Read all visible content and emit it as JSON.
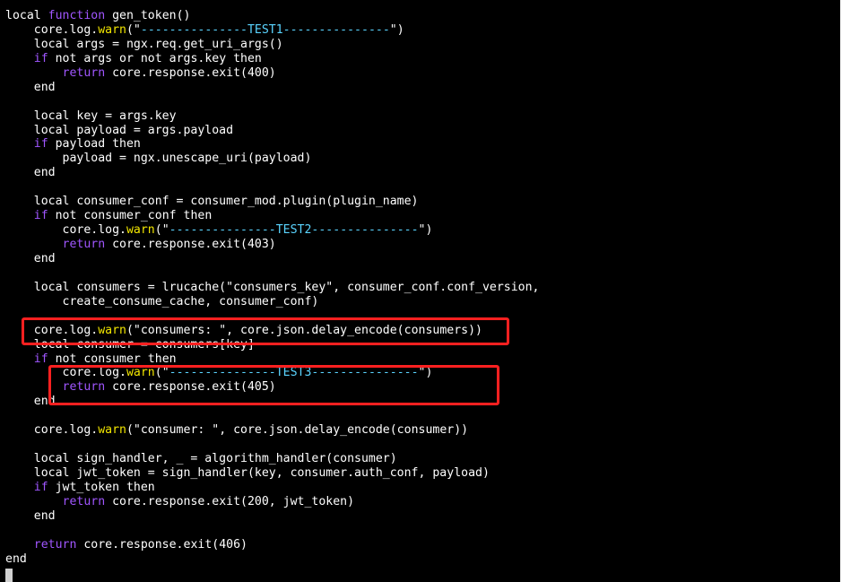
{
  "colors": {
    "background": "#000000",
    "text": "#ffffff",
    "keyword": "#a056ff",
    "warn": "#f2e600",
    "string_dash": "#5ad4ff",
    "highlight_box": "#ff2020"
  },
  "editor": {
    "lines": [
      [
        {
          "t": "local ",
          "c": "p"
        },
        {
          "t": "function",
          "c": "k"
        },
        {
          "t": " gen_token()",
          "c": "p"
        }
      ],
      [
        {
          "t": "    core.log.",
          "c": "p"
        },
        {
          "t": "warn",
          "c": "w"
        },
        {
          "t": "(\"",
          "c": "p"
        },
        {
          "t": "---------------TEST1---------------",
          "c": "c"
        },
        {
          "t": "\")",
          "c": "p"
        }
      ],
      [
        {
          "t": "    local args = ngx.req.get_uri_args()",
          "c": "p"
        }
      ],
      [
        {
          "t": "    ",
          "c": "p"
        },
        {
          "t": "if",
          "c": "k"
        },
        {
          "t": " not args or not args.key then",
          "c": "p"
        }
      ],
      [
        {
          "t": "        ",
          "c": "p"
        },
        {
          "t": "return",
          "c": "k"
        },
        {
          "t": " core.response.exit(400)",
          "c": "p"
        }
      ],
      [
        {
          "t": "    end",
          "c": "p"
        }
      ],
      [
        {
          "t": "",
          "c": "p"
        }
      ],
      [
        {
          "t": "    local key = args.key",
          "c": "p"
        }
      ],
      [
        {
          "t": "    local payload = args.payload",
          "c": "p"
        }
      ],
      [
        {
          "t": "    ",
          "c": "p"
        },
        {
          "t": "if",
          "c": "k"
        },
        {
          "t": " payload then",
          "c": "p"
        }
      ],
      [
        {
          "t": "        payload = ngx.unescape_uri(payload)",
          "c": "p"
        }
      ],
      [
        {
          "t": "    end",
          "c": "p"
        }
      ],
      [
        {
          "t": "",
          "c": "p"
        }
      ],
      [
        {
          "t": "    local consumer_conf = consumer_mod.plugin(plugin_name)",
          "c": "p"
        }
      ],
      [
        {
          "t": "    ",
          "c": "p"
        },
        {
          "t": "if",
          "c": "k"
        },
        {
          "t": " not consumer_conf then",
          "c": "p"
        }
      ],
      [
        {
          "t": "        core.log.",
          "c": "p"
        },
        {
          "t": "warn",
          "c": "w"
        },
        {
          "t": "(\"",
          "c": "p"
        },
        {
          "t": "---------------TEST2---------------",
          "c": "c"
        },
        {
          "t": "\")",
          "c": "p"
        }
      ],
      [
        {
          "t": "        ",
          "c": "p"
        },
        {
          "t": "return",
          "c": "k"
        },
        {
          "t": " core.response.exit(403)",
          "c": "p"
        }
      ],
      [
        {
          "t": "    end",
          "c": "p"
        }
      ],
      [
        {
          "t": "",
          "c": "p"
        }
      ],
      [
        {
          "t": "    local consumers = lrucache(\"consumers_key\", consumer_conf.conf_version,",
          "c": "p"
        }
      ],
      [
        {
          "t": "        create_consume_cache, consumer_conf)",
          "c": "p"
        }
      ],
      [
        {
          "t": "",
          "c": "p"
        }
      ],
      [
        {
          "t": "    core.log.",
          "c": "p"
        },
        {
          "t": "warn",
          "c": "w"
        },
        {
          "t": "(\"consumers: \", core.json.delay_encode(consumers))",
          "c": "p"
        }
      ],
      [
        {
          "t": "    local consumer = consumers[key]",
          "c": "p"
        }
      ],
      [
        {
          "t": "    ",
          "c": "p"
        },
        {
          "t": "if",
          "c": "k"
        },
        {
          "t": " not consumer then",
          "c": "p"
        }
      ],
      [
        {
          "t": "        core.log.",
          "c": "p"
        },
        {
          "t": "warn",
          "c": "w"
        },
        {
          "t": "(\"",
          "c": "p"
        },
        {
          "t": "---------------TEST3---------------",
          "c": "c"
        },
        {
          "t": "\")",
          "c": "p"
        }
      ],
      [
        {
          "t": "        ",
          "c": "p"
        },
        {
          "t": "return",
          "c": "k"
        },
        {
          "t": " core.response.exit(405)",
          "c": "p"
        }
      ],
      [
        {
          "t": "    end",
          "c": "p"
        }
      ],
      [
        {
          "t": "",
          "c": "p"
        }
      ],
      [
        {
          "t": "    core.log.",
          "c": "p"
        },
        {
          "t": "warn",
          "c": "w"
        },
        {
          "t": "(\"consumer: \", core.json.delay_encode(consumer))",
          "c": "p"
        }
      ],
      [
        {
          "t": "",
          "c": "p"
        }
      ],
      [
        {
          "t": "    local sign_handler, _ = algorithm_handler(consumer)",
          "c": "p"
        }
      ],
      [
        {
          "t": "    local jwt_token = sign_handler(key, consumer.auth_conf, payload)",
          "c": "p"
        }
      ],
      [
        {
          "t": "    ",
          "c": "p"
        },
        {
          "t": "if",
          "c": "k"
        },
        {
          "t": " jwt_token then",
          "c": "p"
        }
      ],
      [
        {
          "t": "        ",
          "c": "p"
        },
        {
          "t": "return",
          "c": "k"
        },
        {
          "t": " core.response.exit(200, jwt_token)",
          "c": "p"
        }
      ],
      [
        {
          "t": "    end",
          "c": "p"
        }
      ],
      [
        {
          "t": "",
          "c": "p"
        }
      ],
      [
        {
          "t": "    ",
          "c": "p"
        },
        {
          "t": "return",
          "c": "k"
        },
        {
          "t": " core.response.exit(406)",
          "c": "p"
        }
      ],
      [
        {
          "t": "end",
          "c": "p"
        }
      ]
    ]
  }
}
